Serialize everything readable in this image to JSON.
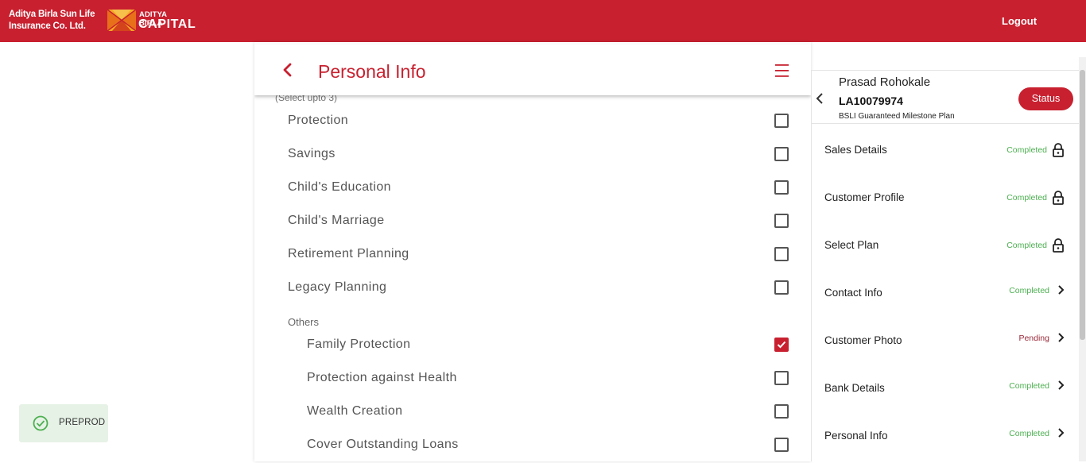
{
  "header": {
    "brand_line1": "Aditya Birla Sun Life",
    "brand_line2": "Insurance Co. Ltd.",
    "capital_line1": "ADITYA BIRLA",
    "capital_line2": "CAPITAL",
    "logout_label": "Logout"
  },
  "page": {
    "title": "Personal Info",
    "select_hint": "(Select upto 3)",
    "goals": [
      {
        "label": "Protection",
        "checked": false
      },
      {
        "label": "Savings",
        "checked": false
      },
      {
        "label": "Child's Education",
        "checked": false
      },
      {
        "label": "Child's Marriage",
        "checked": false
      },
      {
        "label": "Retirement Planning",
        "checked": false
      },
      {
        "label": "Legacy Planning",
        "checked": false
      }
    ],
    "others_label": "Others",
    "others": [
      {
        "label": "Family Protection",
        "checked": true
      },
      {
        "label": "Protection against Health",
        "checked": false
      },
      {
        "label": "Wealth Creation",
        "checked": false
      },
      {
        "label": "Cover Outstanding Loans",
        "checked": false
      }
    ]
  },
  "proposal": {
    "name": "Prasad Rohokale",
    "id": "LA10079974",
    "plan": "BSLI Guaranteed Milestone Plan",
    "status_button": "Status",
    "steps": [
      {
        "name": "Sales Details",
        "status": "Completed",
        "icon": "lock-icon"
      },
      {
        "name": "Customer Profile",
        "status": "Completed",
        "icon": "lock-icon"
      },
      {
        "name": "Select Plan",
        "status": "Completed",
        "icon": "lock-icon"
      },
      {
        "name": "Contact Info",
        "status": "Completed",
        "icon": "chevron-right-icon"
      },
      {
        "name": "Customer Photo",
        "status": "Pending",
        "icon": "chevron-right-icon"
      },
      {
        "name": "Bank Details",
        "status": "Completed",
        "icon": "chevron-right-icon"
      },
      {
        "name": "Personal Info",
        "status": "Completed",
        "icon": "chevron-right-icon"
      }
    ]
  },
  "env_badge": "PREPROD",
  "colors": {
    "brand_red": "#c8202f",
    "completed_green": "#4caf50",
    "pending_maroon": "#9a2a3a"
  }
}
